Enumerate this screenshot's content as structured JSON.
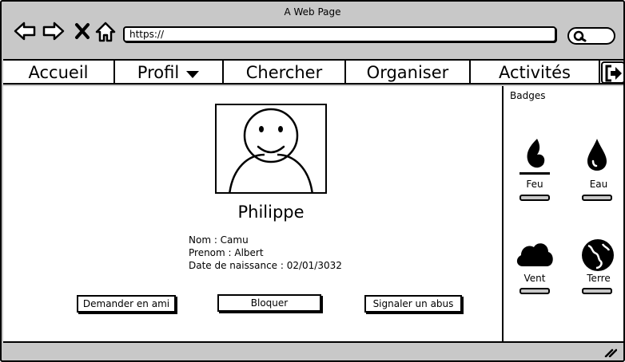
{
  "window": {
    "title": "A Web Page"
  },
  "toolbar": {
    "back_icon": "arrow-left-icon",
    "forward_icon": "arrow-right-icon",
    "stop_icon": "close-icon",
    "home_icon": "home-icon",
    "url": "https://",
    "search_icon": "search-icon"
  },
  "menu": {
    "items": [
      {
        "label": "Accueil"
      },
      {
        "label": "Profil",
        "dropdown": true
      },
      {
        "label": "Chercher"
      },
      {
        "label": "Organiser"
      },
      {
        "label": "Activités"
      }
    ],
    "logout_icon": "sign-out-icon"
  },
  "profile": {
    "name": "Philippe",
    "nom": "Nom : Camu",
    "prenom": "Prenom : Albert",
    "naissance": "Date de naissance : 02/01/3032"
  },
  "actions": {
    "friend": "Demander en ami",
    "block": "Bloquer",
    "report": "Signaler un abus"
  },
  "badges": {
    "title": "Badges",
    "items": [
      {
        "label": "Feu",
        "icon": "fire-icon"
      },
      {
        "label": "Eau",
        "icon": "water-drop-icon"
      },
      {
        "label": "Vent",
        "icon": "cloud-icon"
      },
      {
        "label": "Terre",
        "icon": "globe-icon"
      }
    ]
  },
  "colors": {
    "chrome": "#c8c8c8",
    "ink": "#000000",
    "background": "#ffffff"
  }
}
